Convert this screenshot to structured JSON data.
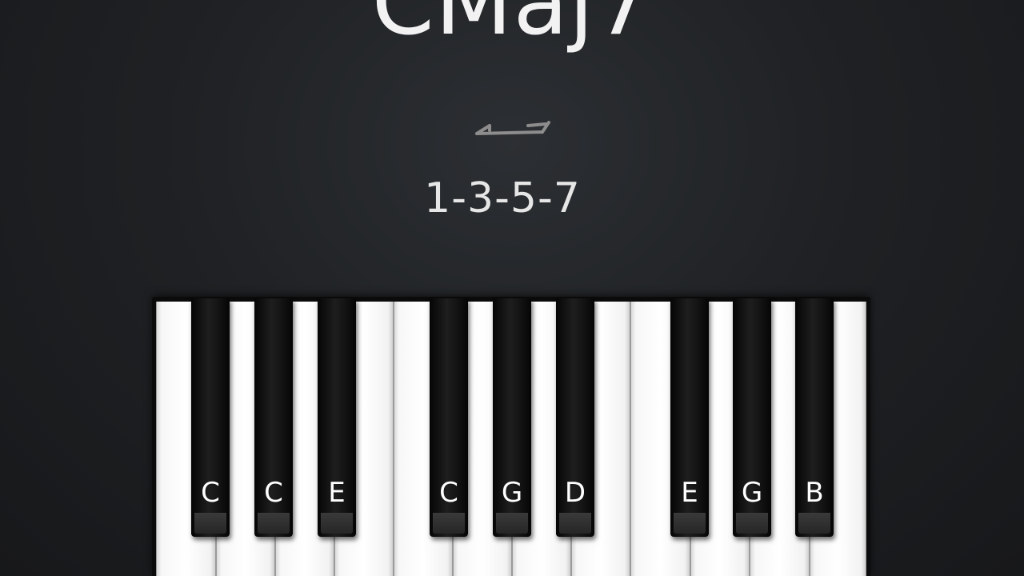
{
  "chord": {
    "name": "CMaj7",
    "degrees": "1-3-5-7"
  },
  "icons": {
    "divider": "bracket-line-icon"
  },
  "keyboard": {
    "white_key_count": 12,
    "black_keys": [
      {
        "label": "C"
      },
      {
        "label": "C"
      },
      {
        "label": "E"
      },
      {
        "label": "C"
      },
      {
        "label": "G"
      },
      {
        "label": "D"
      },
      {
        "label": "E"
      },
      {
        "label": "G"
      },
      {
        "label": "B"
      }
    ]
  },
  "colors": {
    "background": "#1f2124",
    "text": "#f2f2f2",
    "white_key": "#ffffff",
    "black_key": "#111111"
  }
}
